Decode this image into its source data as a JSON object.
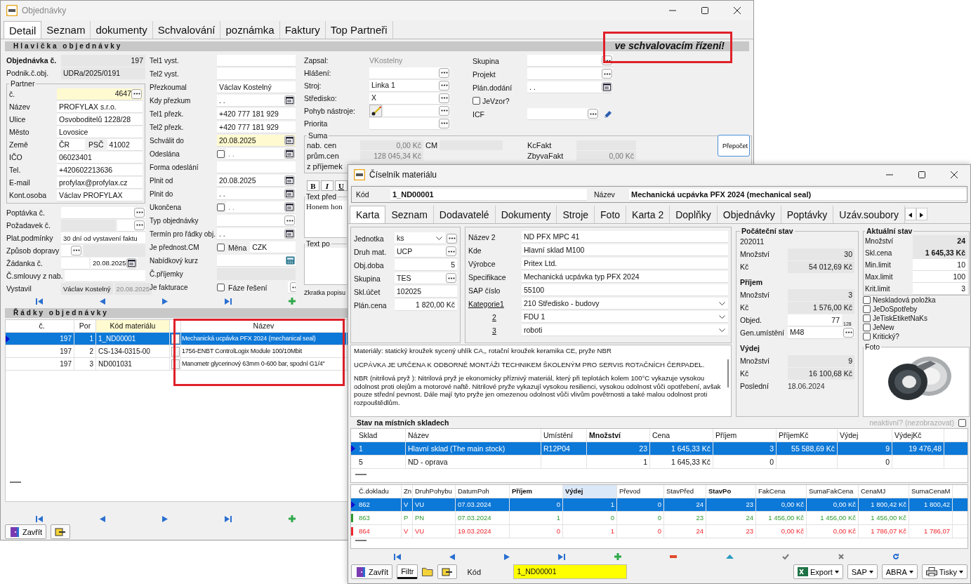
{
  "main_window": {
    "title": "Objednávky",
    "tabs": [
      {
        "label": "Detail",
        "selected": true
      },
      {
        "label": "Seznam",
        "selected": false
      },
      {
        "label": "dokumenty",
        "selected": false
      },
      {
        "label": "Schvalování",
        "selected": false
      },
      {
        "label": "poznámka",
        "selected": false
      },
      {
        "label": "Faktury",
        "selected": false
      },
      {
        "label": "Top Partneři",
        "selected": false
      }
    ],
    "header_section": "Hlavička objednávky",
    "status_banner": "ve schvalovacím řízení!",
    "order_fields": [
      {
        "label": "Objednávka č.",
        "value": "197",
        "kind": "title_number"
      },
      {
        "label": "Podnik.č.obj.",
        "value": "UDRa/2025/0191",
        "kind": "readonly"
      }
    ],
    "partner": {
      "legend": "Partner",
      "fields": [
        {
          "label": "č.",
          "value": "4647",
          "kind": "number_lookup",
          "highlighted": true
        },
        {
          "label": "Název",
          "value": "PROFYLAX s.r.o.",
          "kind": "text",
          "highlighted": false
        },
        {
          "label": "Ulice",
          "value": "Osvoboditelů 1228/28",
          "kind": "text",
          "highlighted": false
        },
        {
          "label": "Město",
          "value": "Lovosice",
          "kind": "text",
          "highlighted": false
        },
        {
          "label": "Země",
          "value": "ČR",
          "sub_label": "PSČ",
          "value2": "41002",
          "kind": "country",
          "highlighted": false
        },
        {
          "label": "IČO",
          "value": "06023401",
          "kind": "text",
          "highlighted": false
        },
        {
          "label": "Tel.",
          "value": "+420602213636",
          "kind": "text",
          "highlighted": false
        },
        {
          "label": "E-mail",
          "value": "profylax@profylax.cz",
          "kind": "text",
          "highlighted": false
        },
        {
          "label": "Kont.osoba",
          "value": "Václav PROFYLAX",
          "kind": "text",
          "highlighted": false
        }
      ]
    },
    "left_fields": [
      {
        "label": "Poptávka č.",
        "kind": "lookup"
      },
      {
        "label": "Požadavek č.",
        "kind": "split_lookup"
      },
      {
        "label": "Plat.podmínky",
        "value": "30 dní od vystavení faktu",
        "kind": "text"
      },
      {
        "label": "Způsob dopravy",
        "kind": "small_lookup"
      },
      {
        "label": "Žádanka č.",
        "value2": "20.08.2025",
        "kind": "split_date"
      },
      {
        "label": "Č.smlouvy z nab.",
        "kind": "text"
      },
      {
        "label": "Vystavil",
        "value": "Václav Kostelný",
        "value2": "20.08.2025",
        "kind": "readonly_pair"
      }
    ],
    "middle_fields": [
      {
        "label": "Tel1 vyst.",
        "kind": "text",
        "highlighted": false
      },
      {
        "label": "Tel2 vyst.",
        "kind": "text",
        "highlighted": false
      },
      {
        "label": "Přezkoumal",
        "value": "Václav Kostelný",
        "kind": "text",
        "highlighted": false
      },
      {
        "label": "Kdy přezkum",
        "value": ". .",
        "kind": "date",
        "highlighted": false
      },
      {
        "label": "Tel1 přezk.",
        "value": "+420 777 181 929",
        "kind": "text",
        "highlighted": false
      },
      {
        "label": "Tel2 přezk.",
        "value": "+420 777 181 929",
        "kind": "text",
        "highlighted": false
      },
      {
        "label": "Schválit do",
        "value": "20.08.2025",
        "kind": "date",
        "highlighted": true
      },
      {
        "label": "Odeslána",
        "value": ". .",
        "kind": "check_date",
        "checked": false,
        "highlighted": false
      },
      {
        "label": "Forma odeslání",
        "kind": "text",
        "highlighted": false
      },
      {
        "label": "Plnit od",
        "value": "20.08.2025",
        "kind": "date",
        "highlighted": false
      },
      {
        "label": "Plnit do",
        "value": ". .",
        "kind": "date",
        "highlighted": false
      },
      {
        "label": "Ukončena",
        "value": ". .",
        "kind": "check_date",
        "checked": false,
        "highlighted": false
      },
      {
        "label": "Typ objednávky",
        "kind": "lookup",
        "highlighted": false
      },
      {
        "label": "Termín pro řádky obj.",
        "value": ". .",
        "kind": "date",
        "highlighted": false
      },
      {
        "label": "Je přednost.CM",
        "sub_label": "Měna",
        "value2": "CZK",
        "kind": "check_text",
        "checked": false,
        "highlighted": false
      },
      {
        "label": "Nabídkový kurz",
        "kind": "calc",
        "highlighted": false
      },
      {
        "label": "Č.příjemky",
        "kind": "readonly",
        "highlighted": false
      },
      {
        "label": "Je fakturace",
        "sub_label": "Fáze řešení",
        "kind": "check_lookup",
        "checked": false,
        "highlighted": false
      }
    ],
    "third_fields": [
      {
        "label": "Zapsal:",
        "value": "VKostelny",
        "kind": "plain"
      },
      {
        "label": "Hlášení:",
        "kind": "lookup"
      },
      {
        "label": "Stroj:",
        "value": "Linka 1",
        "kind": "lookup"
      },
      {
        "label": "Středisko:",
        "value": "X",
        "kind": "lookup"
      },
      {
        "label": "Pohyb nástroje:",
        "kind": "tool_lookup"
      },
      {
        "label": "Priorita",
        "kind": "lookup"
      }
    ],
    "fourth_fields": [
      {
        "label": "Skupina",
        "kind": "lookup"
      },
      {
        "label": "Projekt",
        "kind": "lookup"
      },
      {
        "label": "Plán.dodání",
        "value": ". .",
        "kind": "date"
      },
      {
        "label": "JeVzor?",
        "kind": "checkbox",
        "checked": false
      },
      {
        "label": "ICF",
        "kind": "lookup_edit"
      }
    ],
    "sums": {
      "legend": "Suma",
      "rows": [
        {
          "label": "nab. cen",
          "value": "0,00 Kč",
          "label2": "CM",
          "label3": "KcFakt"
        },
        {
          "label": "prům.cen",
          "value": "128 045,34 Kč",
          "label3": "ZbyvaFakt",
          "value3": "0,00 Kč"
        },
        {
          "label": "z příjemek"
        }
      ],
      "recalc_button": "Přepočet"
    },
    "format_buttons": [
      "B",
      "I",
      "U"
    ],
    "text_before": {
      "legend": "Text před",
      "value": "Honem hon"
    },
    "text_after": {
      "legend": "Text po"
    },
    "short_desc_label": "Zkratka popisu",
    "lines_section": "Řádky objednávky",
    "lines": {
      "columns": [
        "č.",
        "Por",
        "Kód materiálu",
        "Název"
      ],
      "rows": [
        {
          "cells": [
            "197",
            "1",
            "1_ND00001",
            "Mechanická ucpávka PFX 2024 (mechanical seal)"
          ],
          "selected": true
        },
        {
          "cells": [
            "197",
            "2",
            "CS-134-0315-00",
            "1756-ENBT ControlLogix Module 100/10Mbit"
          ],
          "selected": false
        },
        {
          "cells": [
            "197",
            "3",
            "ND001031",
            "Manometr glycerinový 63mm 0-600 bar, spodní G1/4\""
          ],
          "selected": false
        }
      ]
    },
    "close_button": "Zavřít"
  },
  "material_dialog": {
    "title": "Číselník materiálu",
    "code": {
      "label": "Kód",
      "value": "1_ND00001"
    },
    "name": {
      "label": "Název",
      "value": "Mechanická ucpávka PFX 2024 (mechanical seal)"
    },
    "tabs": [
      {
        "label": "Karta",
        "selected": true
      },
      {
        "label": "Seznam",
        "selected": false
      },
      {
        "label": "Dodavatelé",
        "selected": false
      },
      {
        "label": "Dokumenty",
        "selected": false
      },
      {
        "label": "Stroje",
        "selected": false
      },
      {
        "label": "Foto",
        "selected": false
      },
      {
        "label": "Karta 2",
        "selected": false
      },
      {
        "label": "Doplňky",
        "selected": false
      },
      {
        "label": "Objednávky",
        "selected": false
      },
      {
        "label": "Poptávky",
        "selected": false
      },
      {
        "label": "Uzáv.soubory",
        "selected": false
      }
    ],
    "basic_fields": [
      {
        "label": "Jednotka",
        "value": "ks",
        "kind": "combo_lookup"
      },
      {
        "label": "Druh mat.",
        "value": "UCP",
        "kind": "lookup"
      },
      {
        "label": "Obj.doba",
        "value": "5",
        "kind": "number"
      },
      {
        "label": "Skupina",
        "value": "TES",
        "kind": "lookup"
      },
      {
        "label": "Skl.účet",
        "value": "102025",
        "kind": "text"
      },
      {
        "label": "Plán.cena",
        "value": "1 820,00 Kč",
        "kind": "number"
      }
    ],
    "detail_fields": [
      {
        "label": "Název 2",
        "value": "ND PFX MPC 41",
        "kind": "text"
      },
      {
        "label": "Kde",
        "value": "Hlavní sklad M100",
        "kind": "text"
      },
      {
        "label": "Výrobce",
        "value": "Pritex Ltd.",
        "kind": "text"
      },
      {
        "label": "Specifikace",
        "value": "Mechanická ucpávka typ PFX 2024",
        "kind": "text"
      },
      {
        "label": "SAP číslo",
        "value": "55100",
        "kind": "text"
      },
      {
        "label": "Kategorie1",
        "value": "210 Středisko - budovy",
        "kind": "link_combo"
      },
      {
        "label": "2",
        "value": "FDU 1",
        "kind": "link_combo_right"
      },
      {
        "label": "3",
        "value": "roboti",
        "kind": "link_combo_right"
      }
    ],
    "initial_state": {
      "legend": "Počáteční stav",
      "period": "202011",
      "fields": [
        {
          "label": "Množství",
          "value": "30",
          "kind": "readonly_number"
        },
        {
          "label": "Kč",
          "value": "54 012,69 Kč",
          "kind": "readonly_number"
        },
        {
          "label": "Příjem",
          "kind": "heading"
        },
        {
          "label": "Množství",
          "value": "3",
          "kind": "readonly_number"
        },
        {
          "label": "Kč",
          "value": "1 576,00 Kč",
          "kind": "readonly_number"
        },
        {
          "label": "Objed.",
          "value": "77",
          "note": "128",
          "kind": "number_note"
        },
        {
          "label": "Gen.umístění",
          "value": "M48",
          "kind": "lookup"
        },
        {
          "label": "Výdej",
          "kind": "heading"
        },
        {
          "label": "Množství",
          "value": "9",
          "kind": "readonly_number"
        },
        {
          "label": "Kč",
          "value": "16 100,68 Kč",
          "kind": "readonly_number"
        },
        {
          "label": "Poslední",
          "value": "18.06.2024",
          "kind": "plain"
        }
      ]
    },
    "current_state": {
      "legend": "Aktuální stav",
      "fields": [
        {
          "label": "Množství",
          "value": "24",
          "kind": "bold_number"
        },
        {
          "label": "Skl.cena",
          "value": "1 645,33 Kč",
          "kind": "bold_number"
        },
        {
          "label": "Min.limit",
          "value": "10",
          "kind": "number"
        },
        {
          "label": "Max.limit",
          "value": "100",
          "kind": "number"
        },
        {
          "label": "Krit.limit",
          "value": "3",
          "kind": "number"
        }
      ],
      "flags": [
        {
          "label": "Neskladová položka",
          "checked": false
        },
        {
          "label": "JeDoSpotřeby",
          "checked": false
        },
        {
          "label": "JeTiskEtiketNaKs",
          "checked": false
        },
        {
          "label": "JeNew",
          "checked": false
        },
        {
          "label": "Kritický?",
          "checked": false
        }
      ],
      "photo_label": "Foto"
    },
    "description": [
      "Materiály:  statický kroužek sycený uhlík CA,, rotační kroužek keramika CE, pryže NBR",
      "UCPÁVKA JE URČENA K ODBORNÉ MONTÁŽI TECHNIKEM ŠKOLENÝM PRO SERVIS ROTAČNÍCH ČERPADEL.",
      "NBR (nitrilová pryž ): Nitrilová pryž je ekonomicky příznivý materiál, který při teplotách kolem 100°C vykazuje vysokou odolnost proti olejům a motorové naftě. Nitrilové pryže vykazují vysokou resilienci, vysokou odolnost vůči opotřebení, avšak pouze střední pevnost. Dále mají tyto pryže jen omezenou odolnost vůči vlivům povětrnosti a také malou odolnost proti rozpouštědlům."
    ],
    "stock_section": "Stav na místních skladech",
    "inactive_toggle": {
      "label": "neaktivní? (nezobrazovat)",
      "checked": false
    },
    "stock_table": {
      "columns": [
        {
          "label": "Sklad",
          "bold": false
        },
        {
          "label": "Název",
          "bold": false
        },
        {
          "label": "Umístění",
          "bold": false
        },
        {
          "label": "Množství",
          "bold": true
        },
        {
          "label": "Cena",
          "bold": false
        },
        {
          "label": "Příjem",
          "bold": false
        },
        {
          "label": "PříjemKč",
          "bold": false
        },
        {
          "label": "Výdej",
          "bold": false
        },
        {
          "label": "VýdejKč",
          "bold": false
        }
      ],
      "rows": [
        {
          "cells": [
            "1",
            "Hlavní sklad (The main stock)",
            "R12P04",
            "23",
            "1 645,33 Kč",
            "3",
            "55 588,69 Kč",
            "9",
            "19 476,48"
          ],
          "selected": true
        },
        {
          "cells": [
            "5",
            "ND - oprava",
            "",
            "1",
            "1 645,33 Kč",
            "0",
            "",
            "0",
            ""
          ],
          "selected": false
        }
      ]
    },
    "movements_table": {
      "columns": [
        {
          "label": "Č.dokladu",
          "bold": false
        },
        {
          "label": "Zn",
          "bold": false
        },
        {
          "label": "DruhPohybu",
          "bold": false
        },
        {
          "label": "DatumPoh",
          "bold": false
        },
        {
          "label": "Příjem",
          "bold": true
        },
        {
          "label": "Výdej",
          "bold": true
        },
        {
          "label": "Převod",
          "bold": false
        },
        {
          "label": "StavPřed",
          "bold": false
        },
        {
          "label": "StavPo",
          "bold": true
        },
        {
          "label": "FakCena",
          "bold": false
        },
        {
          "label": "SumaFakCena",
          "bold": false
        },
        {
          "label": "CenaMJ",
          "bold": false
        },
        {
          "label": "SumaCenaM",
          "bold": false
        }
      ],
      "rows": [
        {
          "cells": [
            "862",
            "V",
            "VU",
            "07.03.2024",
            "0",
            "1",
            "0",
            "24",
            "23",
            "0,00 Kč",
            "0,00 Kč",
            "1 800,42 Kč",
            "1 800,42"
          ],
          "selected": true
        },
        {
          "cells": [
            "863",
            "P",
            "PN",
            "07.03.2024",
            "1",
            "0",
            "0",
            "23",
            "24",
            "1 456,00 Kč",
            "1 456,00 Kč",
            "1 456,00 Kč",
            ""
          ],
          "selected": false,
          "color": "#2f9a2f"
        },
        {
          "cells": [
            "864",
            "V",
            "VU",
            "19.03.2024",
            "0",
            "1",
            "0",
            "24",
            "23",
            "0,00 Kč",
            "0,00 Kč",
            "1 786,07 Kč",
            "1 786,07"
          ],
          "selected": false,
          "color": "#f0262e"
        }
      ]
    },
    "close_button": "Zavřít",
    "filter_button": "Filtr",
    "code_filter": {
      "label": "Kód",
      "value": "1_ND00001"
    },
    "menu_buttons": [
      {
        "label": "Export",
        "kind": "excel"
      },
      {
        "label": "SAP",
        "kind": "plain"
      },
      {
        "label": "ABRA",
        "kind": "plain"
      },
      {
        "label": "Tisky",
        "kind": "printer"
      }
    ]
  }
}
